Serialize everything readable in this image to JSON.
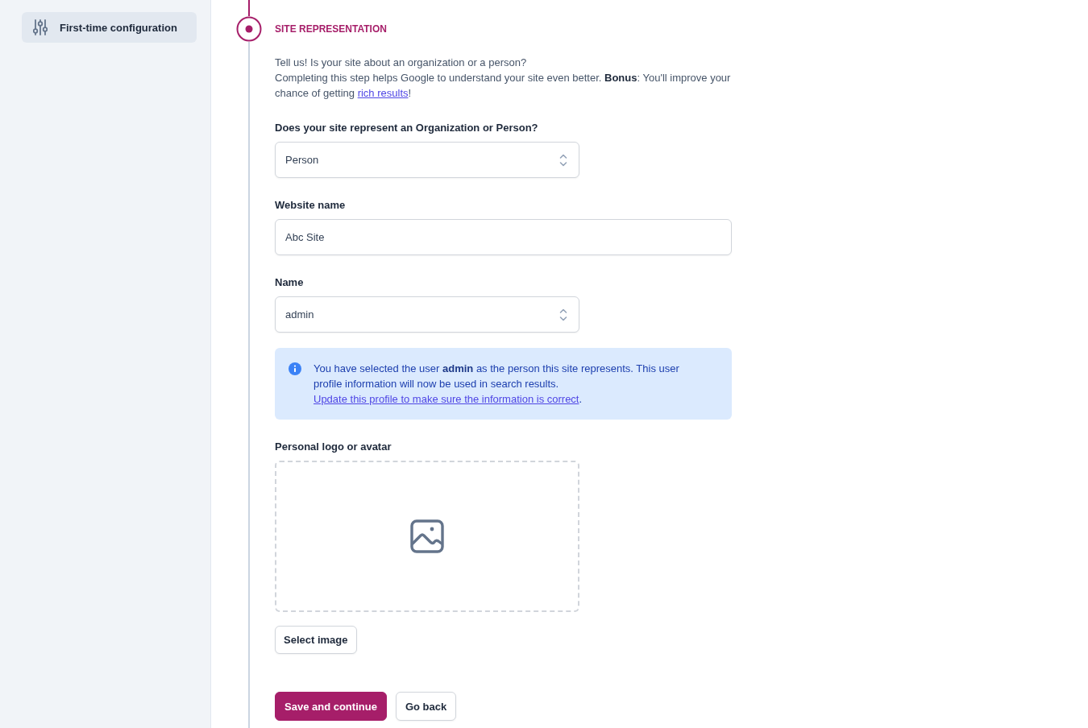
{
  "sidebar": {
    "items": [
      {
        "label": "First-time configuration",
        "selected": true
      }
    ]
  },
  "step": {
    "title": "SITE REPRESENTATION"
  },
  "intro": {
    "line_1": "Tell us! Is your site about an organization or a person?",
    "text": "Completing this step helps Google to understand your site even better. **Bonus**: You'll improve your chance of getting ",
    "link": "rich results",
    "after": "!"
  },
  "fields": [
    {
      "kind": "select",
      "label": "Does your site represent an Organization or Person?",
      "value": "Person"
    },
    {
      "kind": "text",
      "label": "Website name",
      "value": "Abc Site"
    },
    {
      "kind": "select",
      "label": "Name",
      "value": "admin"
    }
  ],
  "alert": {
    "text": "You have selected the user **admin** as the person this site represents. This user profile information will now be used in search results. ",
    "link": "Update this profile to make sure the information is correct",
    "after": "."
  },
  "upload": {
    "label": "Personal logo or avatar",
    "button": "Select image"
  },
  "actions": [
    {
      "kind": "primary",
      "label": "Save and continue"
    },
    {
      "kind": "secondary",
      "label": "Go back"
    }
  ]
}
